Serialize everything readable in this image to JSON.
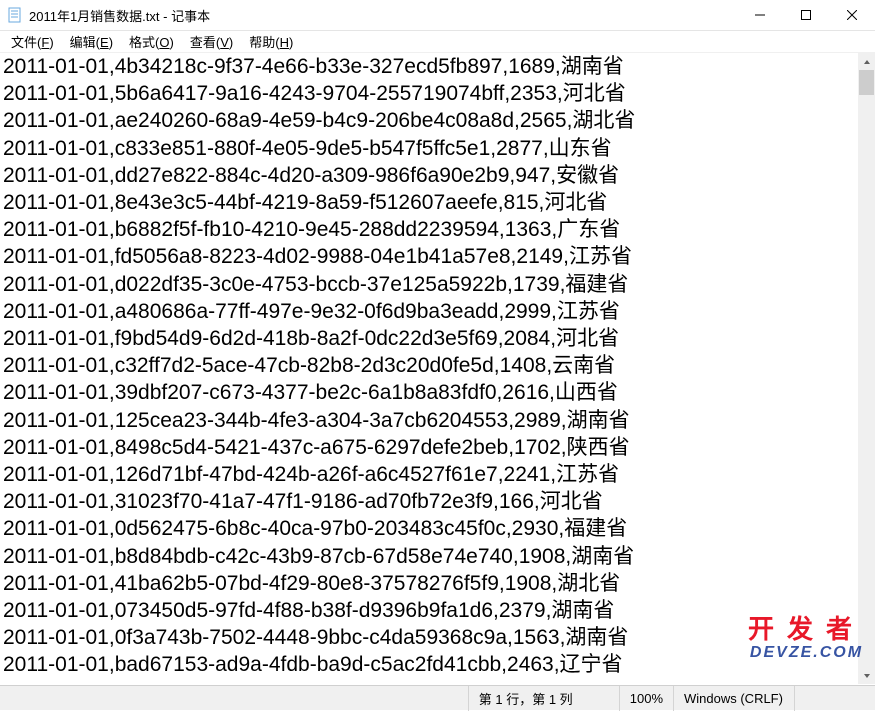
{
  "window": {
    "title": "2011年1月销售数据.txt - 记事本"
  },
  "menu": {
    "file": {
      "label": "文件",
      "key": "F"
    },
    "edit": {
      "label": "编辑",
      "key": "E"
    },
    "format": {
      "label": "格式",
      "key": "O"
    },
    "view": {
      "label": "查看",
      "key": "V"
    },
    "help": {
      "label": "帮助",
      "key": "H"
    }
  },
  "content_lines": [
    "2011-01-01,4b34218c-9f37-4e66-b33e-327ecd5fb897,1689,湖南省",
    "2011-01-01,5b6a6417-9a16-4243-9704-255719074bff,2353,河北省",
    "2011-01-01,ae240260-68a9-4e59-b4c9-206be4c08a8d,2565,湖北省",
    "2011-01-01,c833e851-880f-4e05-9de5-b547f5ffc5e1,2877,山东省",
    "2011-01-01,dd27e822-884c-4d20-a309-986f6a90e2b9,947,安徽省",
    "2011-01-01,8e43e3c5-44bf-4219-8a59-f512607aeefe,815,河北省",
    "2011-01-01,b6882f5f-fb10-4210-9e45-288dd2239594,1363,广东省",
    "2011-01-01,fd5056a8-8223-4d02-9988-04e1b41a57e8,2149,江苏省",
    "2011-01-01,d022df35-3c0e-4753-bccb-37e125a5922b,1739,福建省",
    "2011-01-01,a480686a-77ff-497e-9e32-0f6d9ba3eadd,2999,江苏省",
    "2011-01-01,f9bd54d9-6d2d-418b-8a2f-0dc22d3e5f69,2084,河北省",
    "2011-01-01,c32ff7d2-5ace-47cb-82b8-2d3c20d0fe5d,1408,云南省",
    "2011-01-01,39dbf207-c673-4377-be2c-6a1b8a83fdf0,2616,山西省",
    "2011-01-01,125cea23-344b-4fe3-a304-3a7cb6204553,2989,湖南省",
    "2011-01-01,8498c5d4-5421-437c-a675-6297defe2beb,1702,陕西省",
    "2011-01-01,126d71bf-47bd-424b-a26f-a6c4527f61e7,2241,江苏省",
    "2011-01-01,31023f70-41a7-47f1-9186-ad70fb72e3f9,166,河北省",
    "2011-01-01,0d562475-6b8c-40ca-97b0-203483c45f0c,2930,福建省",
    "2011-01-01,b8d84bdb-c42c-43b9-87cb-67d58e74e740,1908,湖南省",
    "2011-01-01,41ba62b5-07bd-4f29-80e8-37578276f5f9,1908,湖北省",
    "2011-01-01,073450d5-97fd-4f88-b38f-d9396b9fa1d6,2379,湖南省",
    "2011-01-01,0f3a743b-7502-4448-9bbc-c4da59368c9a,1563,湖南省",
    "2011-01-01,bad67153-ad9a-4fdb-ba9d-c5ac2fd41cbb,2463,辽宁省"
  ],
  "statusbar": {
    "cursor": "第 1 行，第 1 列",
    "zoom": "100%",
    "eol": "Windows (CRLF)"
  },
  "watermark": {
    "cn": "开发者",
    "url": "DEVZE.COM"
  }
}
